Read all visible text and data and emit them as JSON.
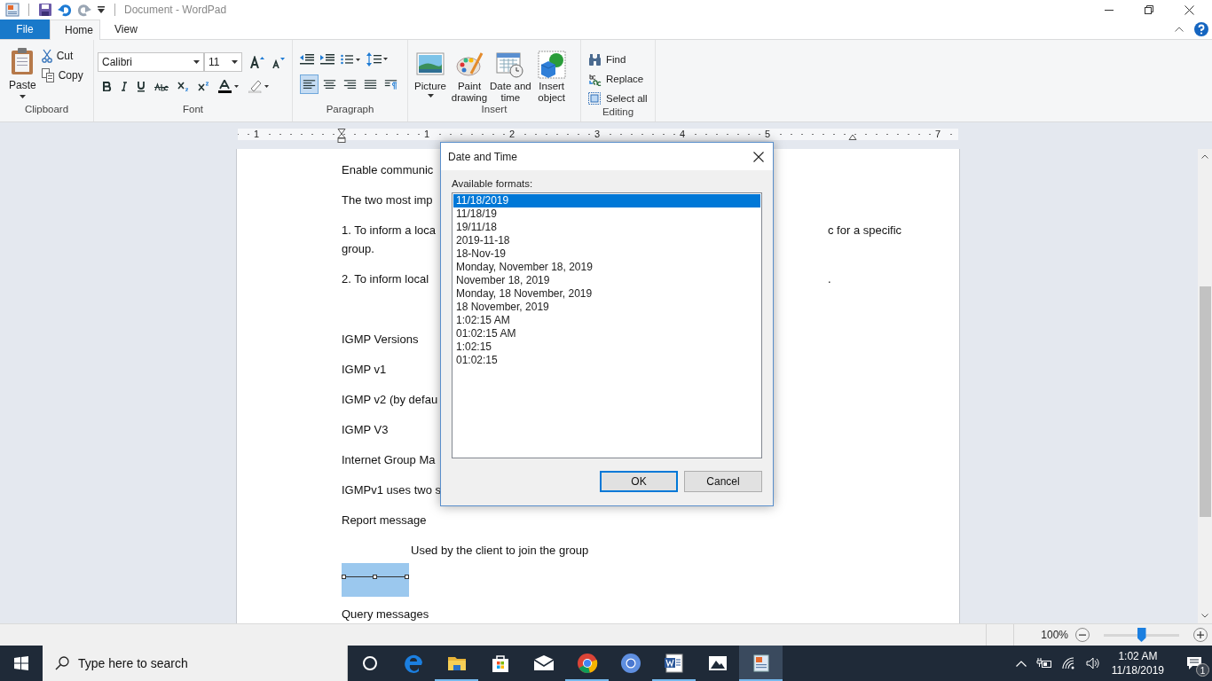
{
  "window": {
    "title": "Document - WordPad"
  },
  "ribbon_tabs": [
    {
      "label": "File",
      "kind": "file",
      "selected": false
    },
    {
      "label": "Home",
      "kind": "tab",
      "selected": true
    },
    {
      "label": "View",
      "kind": "tab",
      "selected": false
    }
  ],
  "clipboard": {
    "label": "Clipboard",
    "paste": "Paste",
    "cut": "Cut",
    "copy": "Copy"
  },
  "font": {
    "label": "Font",
    "font_name": "Calibri",
    "font_size": "11"
  },
  "paragraph": {
    "label": "Paragraph",
    "alignment": [
      {
        "kind": "left",
        "selected": true
      },
      {
        "kind": "center",
        "selected": false
      },
      {
        "kind": "right",
        "selected": false
      },
      {
        "kind": "justify",
        "selected": false
      },
      {
        "kind": "paragraph",
        "selected": false
      }
    ]
  },
  "insert": {
    "label": "Insert",
    "buttons": [
      {
        "kind": "picture",
        "label": "Picture"
      },
      {
        "kind": "paint",
        "label": "Paint\ndrawing"
      },
      {
        "kind": "datetime",
        "label": "Date and\ntime"
      },
      {
        "kind": "object",
        "label": "Insert\nobject"
      }
    ]
  },
  "editing": {
    "label": "Editing",
    "buttons": [
      {
        "kind": "find",
        "label": "Find"
      },
      {
        "kind": "replace",
        "label": "Replace"
      },
      {
        "kind": "selectall",
        "label": "Select all"
      }
    ]
  },
  "ruler": [
    {
      "kind": "number",
      "label": "1"
    },
    {
      "kind": "indent"
    },
    {
      "kind": "number",
      "label": "1"
    },
    {
      "kind": "number",
      "label": "2"
    },
    {
      "kind": "number",
      "label": "3"
    },
    {
      "kind": "number",
      "label": "4"
    },
    {
      "kind": "number",
      "label": "5"
    },
    {
      "kind": "right_indent"
    },
    {
      "kind": "number",
      "label": "7"
    }
  ],
  "document": [
    {
      "kind": "text",
      "lines": [
        {
          "left": "Enable communic"
        }
      ]
    },
    {
      "kind": "text",
      "lines": [
        {
          "left": "The two most imp"
        }
      ]
    },
    {
      "kind": "text",
      "lines": [
        {
          "left": "1. To inform a loca",
          "right": "c for a specific"
        },
        {
          "left": "group."
        }
      ]
    },
    {
      "kind": "text",
      "lines": [
        {
          "left": "2. To inform local",
          "right": "."
        }
      ]
    },
    {
      "kind": "blank"
    },
    {
      "kind": "text",
      "lines": [
        {
          "left": "IGMP Versions"
        }
      ]
    },
    {
      "kind": "text",
      "lines": [
        {
          "left": "IGMP v1"
        }
      ]
    },
    {
      "kind": "text",
      "lines": [
        {
          "left": "IGMP v2 (by defau"
        }
      ]
    },
    {
      "kind": "text",
      "lines": [
        {
          "left": "IGMP V3"
        }
      ]
    },
    {
      "kind": "text",
      "lines": [
        {
          "left": "Internet Group Ma"
        }
      ]
    },
    {
      "kind": "text",
      "lines": [
        {
          "left": "IGMPv1 uses two s"
        }
      ]
    },
    {
      "kind": "text",
      "lines": [
        {
          "left": "Report message"
        }
      ]
    },
    {
      "kind": "indented",
      "lines": [
        {
          "left": "Used by the client to join the group"
        }
      ]
    },
    {
      "kind": "object",
      "selected": true
    },
    {
      "kind": "text",
      "lines": [
        {
          "left": "Query messages"
        }
      ]
    }
  ],
  "dialog": {
    "title": "Date and Time",
    "label": "Available formats:",
    "formats": [
      {
        "text": "11/18/2019",
        "selected": true
      },
      {
        "text": "11/18/19",
        "selected": false
      },
      {
        "text": "19/11/18",
        "selected": false
      },
      {
        "text": "2019-11-18",
        "selected": false
      },
      {
        "text": "18-Nov-19",
        "selected": false
      },
      {
        "text": "Monday, November 18, 2019",
        "selected": false
      },
      {
        "text": "November 18, 2019",
        "selected": false
      },
      {
        "text": "Monday, 18 November, 2019",
        "selected": false
      },
      {
        "text": "18 November, 2019",
        "selected": false
      },
      {
        "text": "1:02:15 AM",
        "selected": false
      },
      {
        "text": "01:02:15 AM",
        "selected": false
      },
      {
        "text": "1:02:15",
        "selected": false
      },
      {
        "text": "01:02:15",
        "selected": false
      }
    ],
    "buttons": [
      {
        "label": "OK",
        "default": true
      },
      {
        "label": "Cancel",
        "default": false
      }
    ]
  },
  "status_bar": {
    "zoom": "100%",
    "zoom_slider": {
      "level": 0.5
    }
  },
  "taskbar": {
    "search_placeholder": "Type here to search",
    "apps": [
      {
        "kind": "cortana",
        "running": false,
        "active": false
      },
      {
        "kind": "edge",
        "running": false,
        "active": false
      },
      {
        "kind": "explorer",
        "running": true,
        "active": false
      },
      {
        "kind": "store",
        "running": false,
        "active": false
      },
      {
        "kind": "mail",
        "running": false,
        "active": false
      },
      {
        "kind": "chrome",
        "running": true,
        "active": false
      },
      {
        "kind": "chromium",
        "running": false,
        "active": false
      },
      {
        "kind": "word",
        "running": true,
        "active": false
      },
      {
        "kind": "photos",
        "running": false,
        "active": false
      },
      {
        "kind": "wordpad",
        "running": true,
        "active": true
      }
    ],
    "time": "1:02 AM",
    "date": "11/18/2019",
    "notifications": "1"
  }
}
